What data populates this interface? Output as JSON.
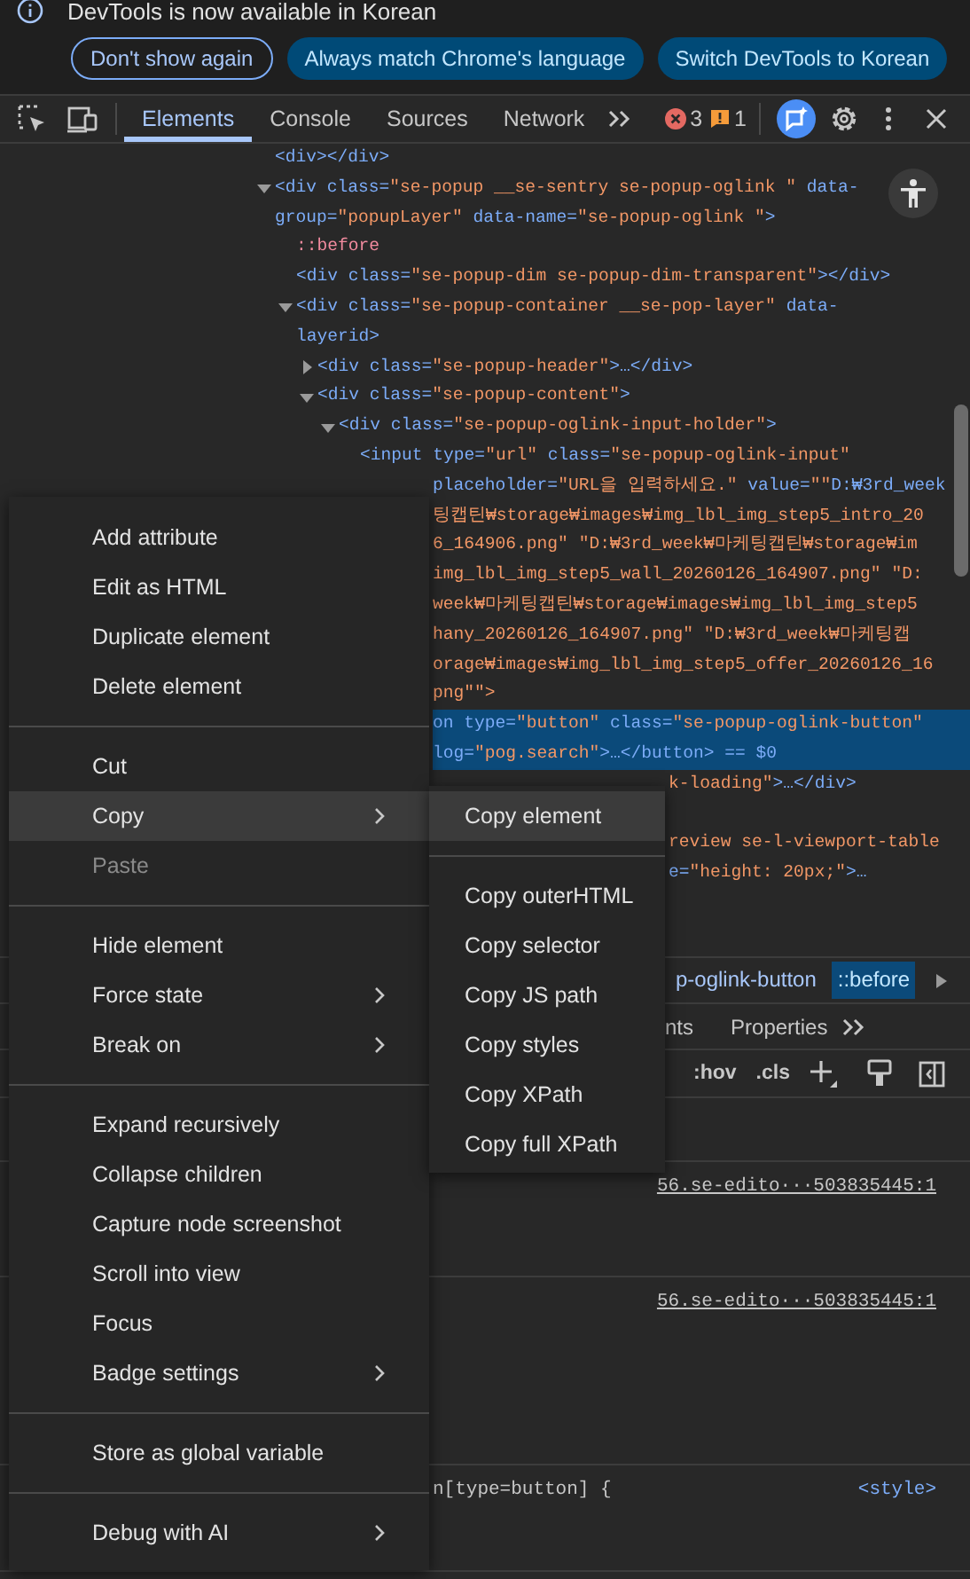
{
  "infobar": {
    "message": "DevTools is now available in Korean",
    "buttons": [
      {
        "label": "Don't show again",
        "kind": "outline"
      },
      {
        "label": "Always match Chrome's language",
        "kind": "filled"
      },
      {
        "label": "Switch DevTools to Korean",
        "kind": "filled"
      }
    ]
  },
  "toolbar": {
    "tabs": [
      {
        "label": "Elements",
        "selected": true
      },
      {
        "label": "Console",
        "selected": false
      },
      {
        "label": "Sources",
        "selected": false
      },
      {
        "label": "Network",
        "selected": false
      }
    ],
    "errors": "3",
    "warnings": "1"
  },
  "dom_tree": [
    {
      "selected": false,
      "lines": [
        {
          "text": "<div></div>",
          "kind": "markup"
        }
      ]
    },
    {
      "selected": false,
      "expanded": true,
      "lines": [
        {
          "text": "<div class=\"se-popup __se-sentry se-popup-oglink \" data-",
          "kind": "markup"
        },
        {
          "text": "group=\"popupLayer\" data-name=\"se-popup-oglink \">",
          "kind": "markup"
        }
      ],
      "children": [
        {
          "selected": false,
          "lines": [
            {
              "text": "::before",
              "kind": "pseudo"
            }
          ]
        },
        {
          "selected": false,
          "lines": [
            {
              "text": "<div class=\"se-popup-dim se-popup-dim-transparent\"></div>",
              "kind": "markup"
            }
          ]
        },
        {
          "selected": false,
          "expanded": true,
          "lines": [
            {
              "text": "<div class=\"se-popup-container __se-pop-layer\" data-",
              "kind": "markup"
            },
            {
              "text": "layerid>",
              "kind": "markup"
            }
          ],
          "children": [
            {
              "selected": false,
              "expanded": false,
              "lines": [
                {
                  "text": "<div class=\"se-popup-header\">…</div>",
                  "kind": "markup"
                }
              ]
            },
            {
              "selected": false,
              "expanded": true,
              "lines": [
                {
                  "text": "<div class=\"se-popup-content\">",
                  "kind": "markup"
                }
              ],
              "children": [
                {
                  "selected": false,
                  "expanded": true,
                  "lines": [
                    {
                      "text": "<div class=\"se-popup-oglink-input-holder\">",
                      "kind": "markup"
                    }
                  ],
                  "children": [
                    {
                      "selected": false,
                      "lines": [
                        {
                          "text": "<input type=\"url\" class=\"se-popup-oglink-input\"",
                          "kind": "markup"
                        },
                        {
                          "text": "placeholder=\"URL을 입력하세요.\" value=\"\"D:₩3rd_week",
                          "kind": "markup"
                        },
                        {
                          "text": "팅캡틴₩storage₩images₩img_lbl_img_step5_intro_20",
                          "kind": "value"
                        },
                        {
                          "text": "6_164906.png\" \"D:₩3rd_week₩마케팅캡틴₩storage₩im",
                          "kind": "value"
                        },
                        {
                          "text": "img_lbl_img_step5_wall_20260126_164907.png\" \"D:",
                          "kind": "value"
                        },
                        {
                          "text": "week₩마케팅캡틴₩storage₩images₩img_lbl_img_step5",
                          "kind": "value"
                        },
                        {
                          "text": "hany_20260126_164907.png\" \"D:₩3rd_week₩마케팅캡",
                          "kind": "value"
                        },
                        {
                          "text": "orage₩images₩img_lbl_img_step5_offer_20260126_16",
                          "kind": "value"
                        },
                        {
                          "text": "png\"\">",
                          "kind": "value"
                        }
                      ]
                    },
                    {
                      "selected": true,
                      "lines": [
                        {
                          "text": "on type=\"button\" class=\"se-popup-oglink-button\"",
                          "kind": "markup"
                        },
                        {
                          "text": "log=\"pog.search\">…</button> == $0",
                          "kind": "markup"
                        }
                      ]
                    },
                    {
                      "selected": false,
                      "lines": [
                        {
                          "text": "k-loading\">…</div>",
                          "kind": "value"
                        }
                      ]
                    },
                    {
                      "selected": false,
                      "lines": [
                        {
                          "text": "review se-l-viewport-table",
                          "kind": "value",
                          "covered_above": true
                        },
                        {
                          "text": "e=\"height: 20px;\">…",
                          "kind": "markup"
                        }
                      ]
                    }
                  ]
                }
              ]
            }
          ]
        }
      ]
    }
  ],
  "breadcrumbs": [
    {
      "label": "p-oglink-button",
      "selected": false
    },
    {
      "label": "::before",
      "selected": true
    }
  ],
  "sidebar_tabs": [
    {
      "label": "nts",
      "selected": false
    },
    {
      "label": "Properties",
      "selected": false
    }
  ],
  "style_filter": {
    "hover_toggle": ":hov",
    "class_toggle": ".cls"
  },
  "style_rules": [
    {
      "source": "56.se-edito···503835445:1"
    },
    {
      "source": "56.se-edito···503835445:1"
    },
    {
      "selector": "n[type=button] {",
      "source": "<style>"
    }
  ],
  "context_menu": {
    "groups": [
      [
        {
          "label": "Add attribute",
          "selected": false,
          "disabled": false,
          "submenu": false
        },
        {
          "label": "Edit as HTML",
          "selected": false,
          "disabled": false,
          "submenu": false
        },
        {
          "label": "Duplicate element",
          "selected": false,
          "disabled": false,
          "submenu": false
        },
        {
          "label": "Delete element",
          "selected": false,
          "disabled": false,
          "submenu": false
        }
      ],
      [
        {
          "label": "Cut",
          "selected": false,
          "disabled": false,
          "submenu": false
        },
        {
          "label": "Copy",
          "selected": true,
          "disabled": false,
          "submenu": true
        },
        {
          "label": "Paste",
          "selected": false,
          "disabled": true,
          "submenu": false
        }
      ],
      [
        {
          "label": "Hide element",
          "selected": false,
          "disabled": false,
          "submenu": false
        },
        {
          "label": "Force state",
          "selected": false,
          "disabled": false,
          "submenu": true
        },
        {
          "label": "Break on",
          "selected": false,
          "disabled": false,
          "submenu": true
        }
      ],
      [
        {
          "label": "Expand recursively",
          "selected": false,
          "disabled": false,
          "submenu": false
        },
        {
          "label": "Collapse children",
          "selected": false,
          "disabled": false,
          "submenu": false
        },
        {
          "label": "Capture node screenshot",
          "selected": false,
          "disabled": false,
          "submenu": false
        },
        {
          "label": "Scroll into view",
          "selected": false,
          "disabled": false,
          "submenu": false
        },
        {
          "label": "Focus",
          "selected": false,
          "disabled": false,
          "submenu": false
        },
        {
          "label": "Badge settings",
          "selected": false,
          "disabled": false,
          "submenu": true
        }
      ],
      [
        {
          "label": "Store as global variable",
          "selected": false,
          "disabled": false,
          "submenu": false
        }
      ],
      [
        {
          "label": "Debug with AI",
          "selected": false,
          "disabled": false,
          "submenu": true
        }
      ]
    ]
  },
  "copy_submenu": {
    "groups": [
      [
        {
          "label": "Copy element",
          "selected": true
        }
      ],
      [
        {
          "label": "Copy outerHTML",
          "selected": false
        },
        {
          "label": "Copy selector",
          "selected": false
        },
        {
          "label": "Copy JS path",
          "selected": false
        },
        {
          "label": "Copy styles",
          "selected": false
        },
        {
          "label": "Copy XPath",
          "selected": false
        },
        {
          "label": "Copy full XPath",
          "selected": false
        }
      ]
    ]
  }
}
